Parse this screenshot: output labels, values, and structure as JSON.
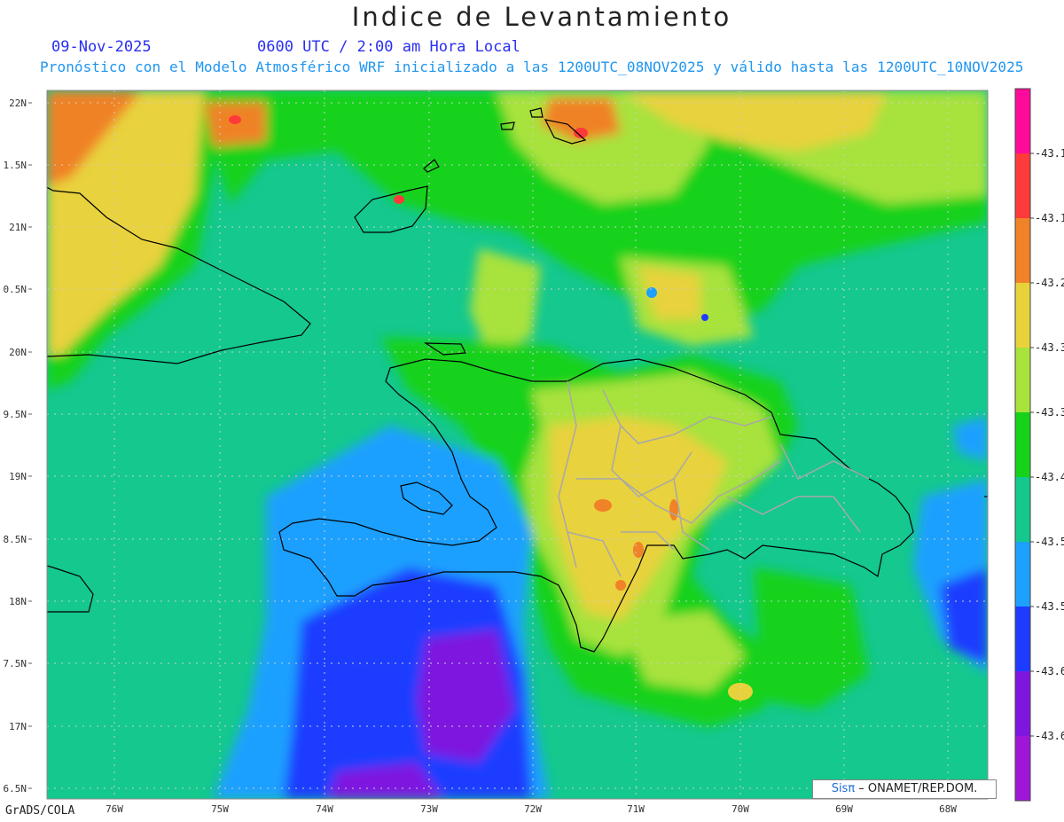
{
  "header": {
    "title": "Indice de Levantamiento",
    "date": "09-Nov-2025",
    "time": "0600 UTC / 2:00 am Hora Local",
    "description": "Pronóstico con el Modelo Atmosférico WRF inicializado a las 1200UTC_08NOV2025 y válido hasta las  1200UTC_10NOV2025"
  },
  "map": {
    "lat_labels": [
      "22N",
      "1.5N",
      "21N",
      "0.5N",
      "20N",
      "9.5N",
      "19N",
      "8.5N",
      "18N",
      "7.5N",
      "17N",
      "6.5N"
    ],
    "lon_labels": [
      "76W",
      "75W",
      "74W",
      "73W",
      "72W",
      "71W",
      "70W",
      "69W",
      "68W"
    ]
  },
  "colorbar": {
    "colors": [
      "#ff0a9a",
      "#ff3a3a",
      "#f08228",
      "#e8d23c",
      "#a8e23c",
      "#16d21a",
      "#14c88e",
      "#1ea0ff",
      "#1e3cff",
      "#7e16e0",
      "#a016d8"
    ],
    "labels": [
      "-43.1",
      "-43.1",
      "-43.2",
      "-43.3",
      "-43.3",
      "-43.4",
      "-43.5",
      "-43.5",
      "-43.6",
      "-43.6"
    ]
  },
  "footer": {
    "credit": "GrADS/COLA",
    "stamp_brand": "Sisπ",
    "stamp_text": " – ONAMET/REP.DOM."
  }
}
